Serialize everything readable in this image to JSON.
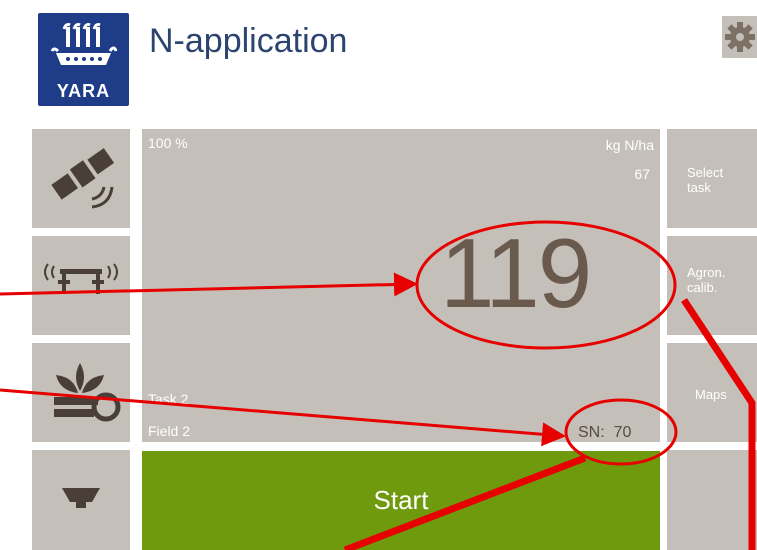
{
  "brand": {
    "logo_text": "YARA"
  },
  "header": {
    "title": "N-application"
  },
  "panel": {
    "percent": "100 %",
    "unit": "kg N/ha",
    "target": "67",
    "rate": "119",
    "task": "Task 2",
    "field": "Field 2",
    "sn_label": "SN:",
    "sn_value": "70"
  },
  "start_button": {
    "label": "Start"
  },
  "right_menu": [
    {
      "label": "Select\ntask"
    },
    {
      "label": "Agron.\ncalib."
    },
    {
      "label": "Maps"
    }
  ],
  "left_menu_icons": [
    "satellite-icon",
    "sensor-boom-icon",
    "crop-tool-icon",
    "hopper-icon"
  ],
  "colors": {
    "logo_bg": "#1f3c88",
    "button_gray": "#c4bfb9",
    "start_green": "#6f9a0d",
    "annotation_red": "#e60000",
    "title_blue": "#2b4470"
  }
}
